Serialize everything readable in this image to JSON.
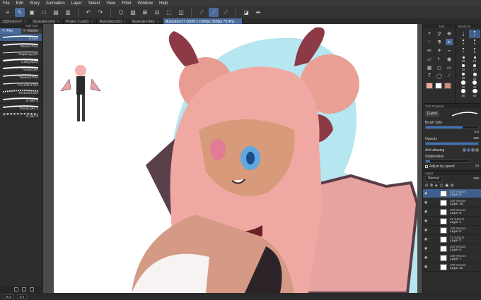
{
  "menu": [
    "File",
    "Edit",
    "Story",
    "Animation",
    "Layer",
    "Select",
    "View",
    "Filter",
    "Window",
    "Help"
  ],
  "command_bar": {
    "icons": [
      "hamburger-icon",
      "pen-tool-icon",
      "gallery-icon",
      "new-icon",
      "open-icon",
      "save-icon",
      "undo-icon",
      "redo-icon",
      "fill-icon",
      "clear-icon",
      "transform-icon",
      "grid-icon",
      "deselect-icon",
      "ruler-icon",
      "lasso-icon",
      "stabilize-icon",
      "snap-icon",
      "ruler2-icon",
      "flip-icon"
    ]
  },
  "tabs": [
    {
      "label": "33(Restore)*",
      "active": false
    },
    {
      "label": "Illustration34()",
      "active": false
    },
    {
      "label": "Project 2.psd()",
      "active": false
    },
    {
      "label": "Illustration32()",
      "active": false
    },
    {
      "label": "Illustration36()",
      "active": false
    },
    {
      "label": "Illustration27 (2626 x 1950px 350dpi 75.4%)",
      "active": true
    }
  ],
  "subtool_panel": {
    "header": "Sub Tool",
    "tabs": [
      {
        "label": "Pen",
        "active": true
      },
      {
        "label": "Marker",
        "active": false
      }
    ],
    "brushes": [
      {
        "name": "G-pen",
        "selected": true
      },
      {
        "name": "Real G-Pen",
        "selected": false
      },
      {
        "name": "Mapping pen",
        "selected": false
      },
      {
        "name": "Calligraphy",
        "selected": false
      },
      {
        "name": "Turnip pen",
        "selected": false
      },
      {
        "name": "Tapered Pen",
        "selected": false
      },
      {
        "name": "For effect line",
        "selected": false
      },
      {
        "name": "Textured pen",
        "selected": false
      },
      {
        "name": "G-pen 2",
        "selected": false
      },
      {
        "name": "Turnip pen 2",
        "selected": false
      },
      {
        "name": "G-pen 3",
        "selected": false
      }
    ]
  },
  "tool_panel": {
    "header": "Tool",
    "tools": [
      "select-icon",
      "zoom-icon",
      "move-icon",
      "lasso-select-icon",
      "eyedropper-icon",
      "pen-icon",
      "pencil-icon",
      "brush-icon",
      "airbrush-icon",
      "eraser-icon",
      "blend-icon",
      "fill-icon",
      "gradient-icon",
      "figure-icon",
      "frame-icon",
      "text-icon",
      "balloon-icon",
      "correction-icon"
    ],
    "colors": {
      "main": "#f0a898",
      "sub": "#ffffff",
      "accent": "#d88a80"
    }
  },
  "brush_size_panel": {
    "header": "Brush Si",
    "sizes": [
      "3",
      "4",
      "5",
      "6",
      "7",
      "8",
      "10",
      "12",
      "15",
      "17",
      "20",
      "25",
      "30",
      "40",
      "50",
      "60"
    ],
    "selected": "4"
  },
  "tool_property": {
    "header": "Tool Property",
    "tool_name": "G-pen",
    "brush_size_label": "Brush Size",
    "brush_size_value": "4.0",
    "opacity_label": "Opacity",
    "opacity_value": "100",
    "antialias_label": "Anti-aliasing",
    "stabilization_label": "Stabilization",
    "stabilization_value": "10",
    "adjust_label": "Adjust by speed"
  },
  "layer_panel": {
    "header": "Layer",
    "blend_mode": "Normal",
    "opacity": "100",
    "layers": [
      {
        "pct": "100 %Norm",
        "name": "Layer 8",
        "selected": true
      },
      {
        "pct": "100 %Norm",
        "name": "Layer 16",
        "selected": false
      },
      {
        "pct": "100 %Norm",
        "name": "Layer 9",
        "selected": false
      },
      {
        "pct": "61 %Norm",
        "name": "Layer 1",
        "selected": false
      },
      {
        "pct": "100 %Norm",
        "name": "Layer 5",
        "selected": false
      },
      {
        "pct": "71 %Norm",
        "name": "Layer 2",
        "selected": false
      },
      {
        "pct": "100 %Norm",
        "name": "Layer 6",
        "selected": false
      },
      {
        "pct": "100 %Norm",
        "name": "Layer 7",
        "selected": false
      },
      {
        "pct": "100 %Norm",
        "name": "Layer 11",
        "selected": false
      }
    ]
  },
  "status": {
    "zoom": "75.4",
    "angle": "0.0"
  }
}
